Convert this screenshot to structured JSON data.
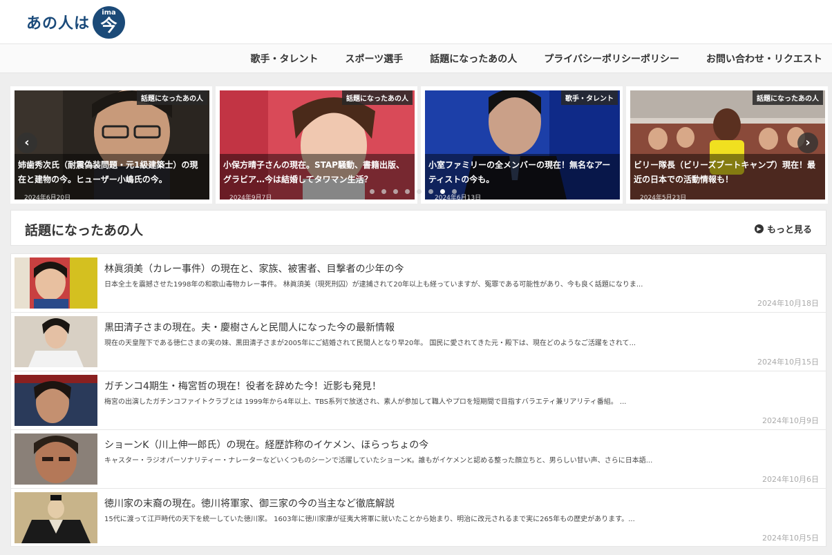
{
  "header": {
    "logo_text": "あの人は",
    "logo_badge_small": "ima",
    "logo_badge_kanji": "今"
  },
  "nav": {
    "items": [
      "歌手・タレント",
      "スポーツ選手",
      "話題になったあの人",
      "プライバシーポリシーポリシー",
      "お問い合わせ・リクエスト"
    ]
  },
  "carousel": {
    "prev": "‹",
    "next": "›",
    "slides": [
      {
        "tag": "話題になったあの人",
        "title": "姉歯秀次氏（耐震偽装問題・元1級建築士）の現在と建物の今。ヒューザー小嶋氏の今。",
        "date": "2024年6月20日"
      },
      {
        "tag": "話題になったあの人",
        "title": "小保方晴子さんの現在。STAP騒動、書籍出版、グラビア…今は結婚してタワマン生活？",
        "date": "2024年9月7日"
      },
      {
        "tag": "歌手・タレント",
        "title": "小室ファミリーの全メンバーの現在！無名なアーティストの今も。",
        "date": "2024年6月13日"
      },
      {
        "tag": "話題になったあの人",
        "title": "ビリー隊長（ビリーズブートキャンプ）現在！最近の日本での活動情報も！",
        "date": "2024年5月23日"
      }
    ]
  },
  "section": {
    "title": "話題になったあの人",
    "more": "もっと見る"
  },
  "articles": [
    {
      "title": "林眞須美（カレー事件）の現在と、家族、被害者、目撃者の少年の今",
      "excerpt": "日本全土を震撼させた1998年の和歌山毒物カレー事件。 林眞須美（現死刑囚）が逮捕されて20年以上も経っていますが、冤罪である可能性があり、今も良く話題になりま...",
      "date": "2024年10月18日"
    },
    {
      "title": "黒田清子さまの現在。夫・慶樹さんと民間人になった今の最新情報",
      "excerpt": "現在の天皇陛下である徳仁さまの実の妹、黒田清子さまが2005年にご結婚されて民間人となり早20年。 国民に愛されてきた元・殿下は、現在どのようなご活躍をされて...",
      "date": "2024年10月15日"
    },
    {
      "title": "ガチンコ4期生・梅宮哲の現在！役者を辞めた今！近影も発見！",
      "excerpt": "梅宮の出演したガチンコファイトクラブとは 1999年から4年以上、TBS系列で放送され、素人が参加して職人やプロを短期間で目指すバラエティ兼リアリティ番組。 ...",
      "date": "2024年10月9日"
    },
    {
      "title": "ショーンK（川上伸一郎氏）の現在。経歴詐称のイケメン、ほらっちょの今",
      "excerpt": "キャスター・ラジオパーソナリティー・ナレーターなどいくつものシーンで活躍していたショーンK。誰もがイケメンと認める整った顔立ちと、男らしい甘い声、さらに日本語...",
      "date": "2024年10月6日"
    },
    {
      "title": "徳川家の末裔の現在。徳川将軍家、御三家の今の当主など徹底解説",
      "excerpt": "15代に渡って江戸時代の天下を統一していた徳川家。 1603年に徳川家康が征夷大将軍に就いたことから始まり、明治に改元されるまで実に265年もの歴史があります。...",
      "date": "2024年10月5日"
    }
  ]
}
